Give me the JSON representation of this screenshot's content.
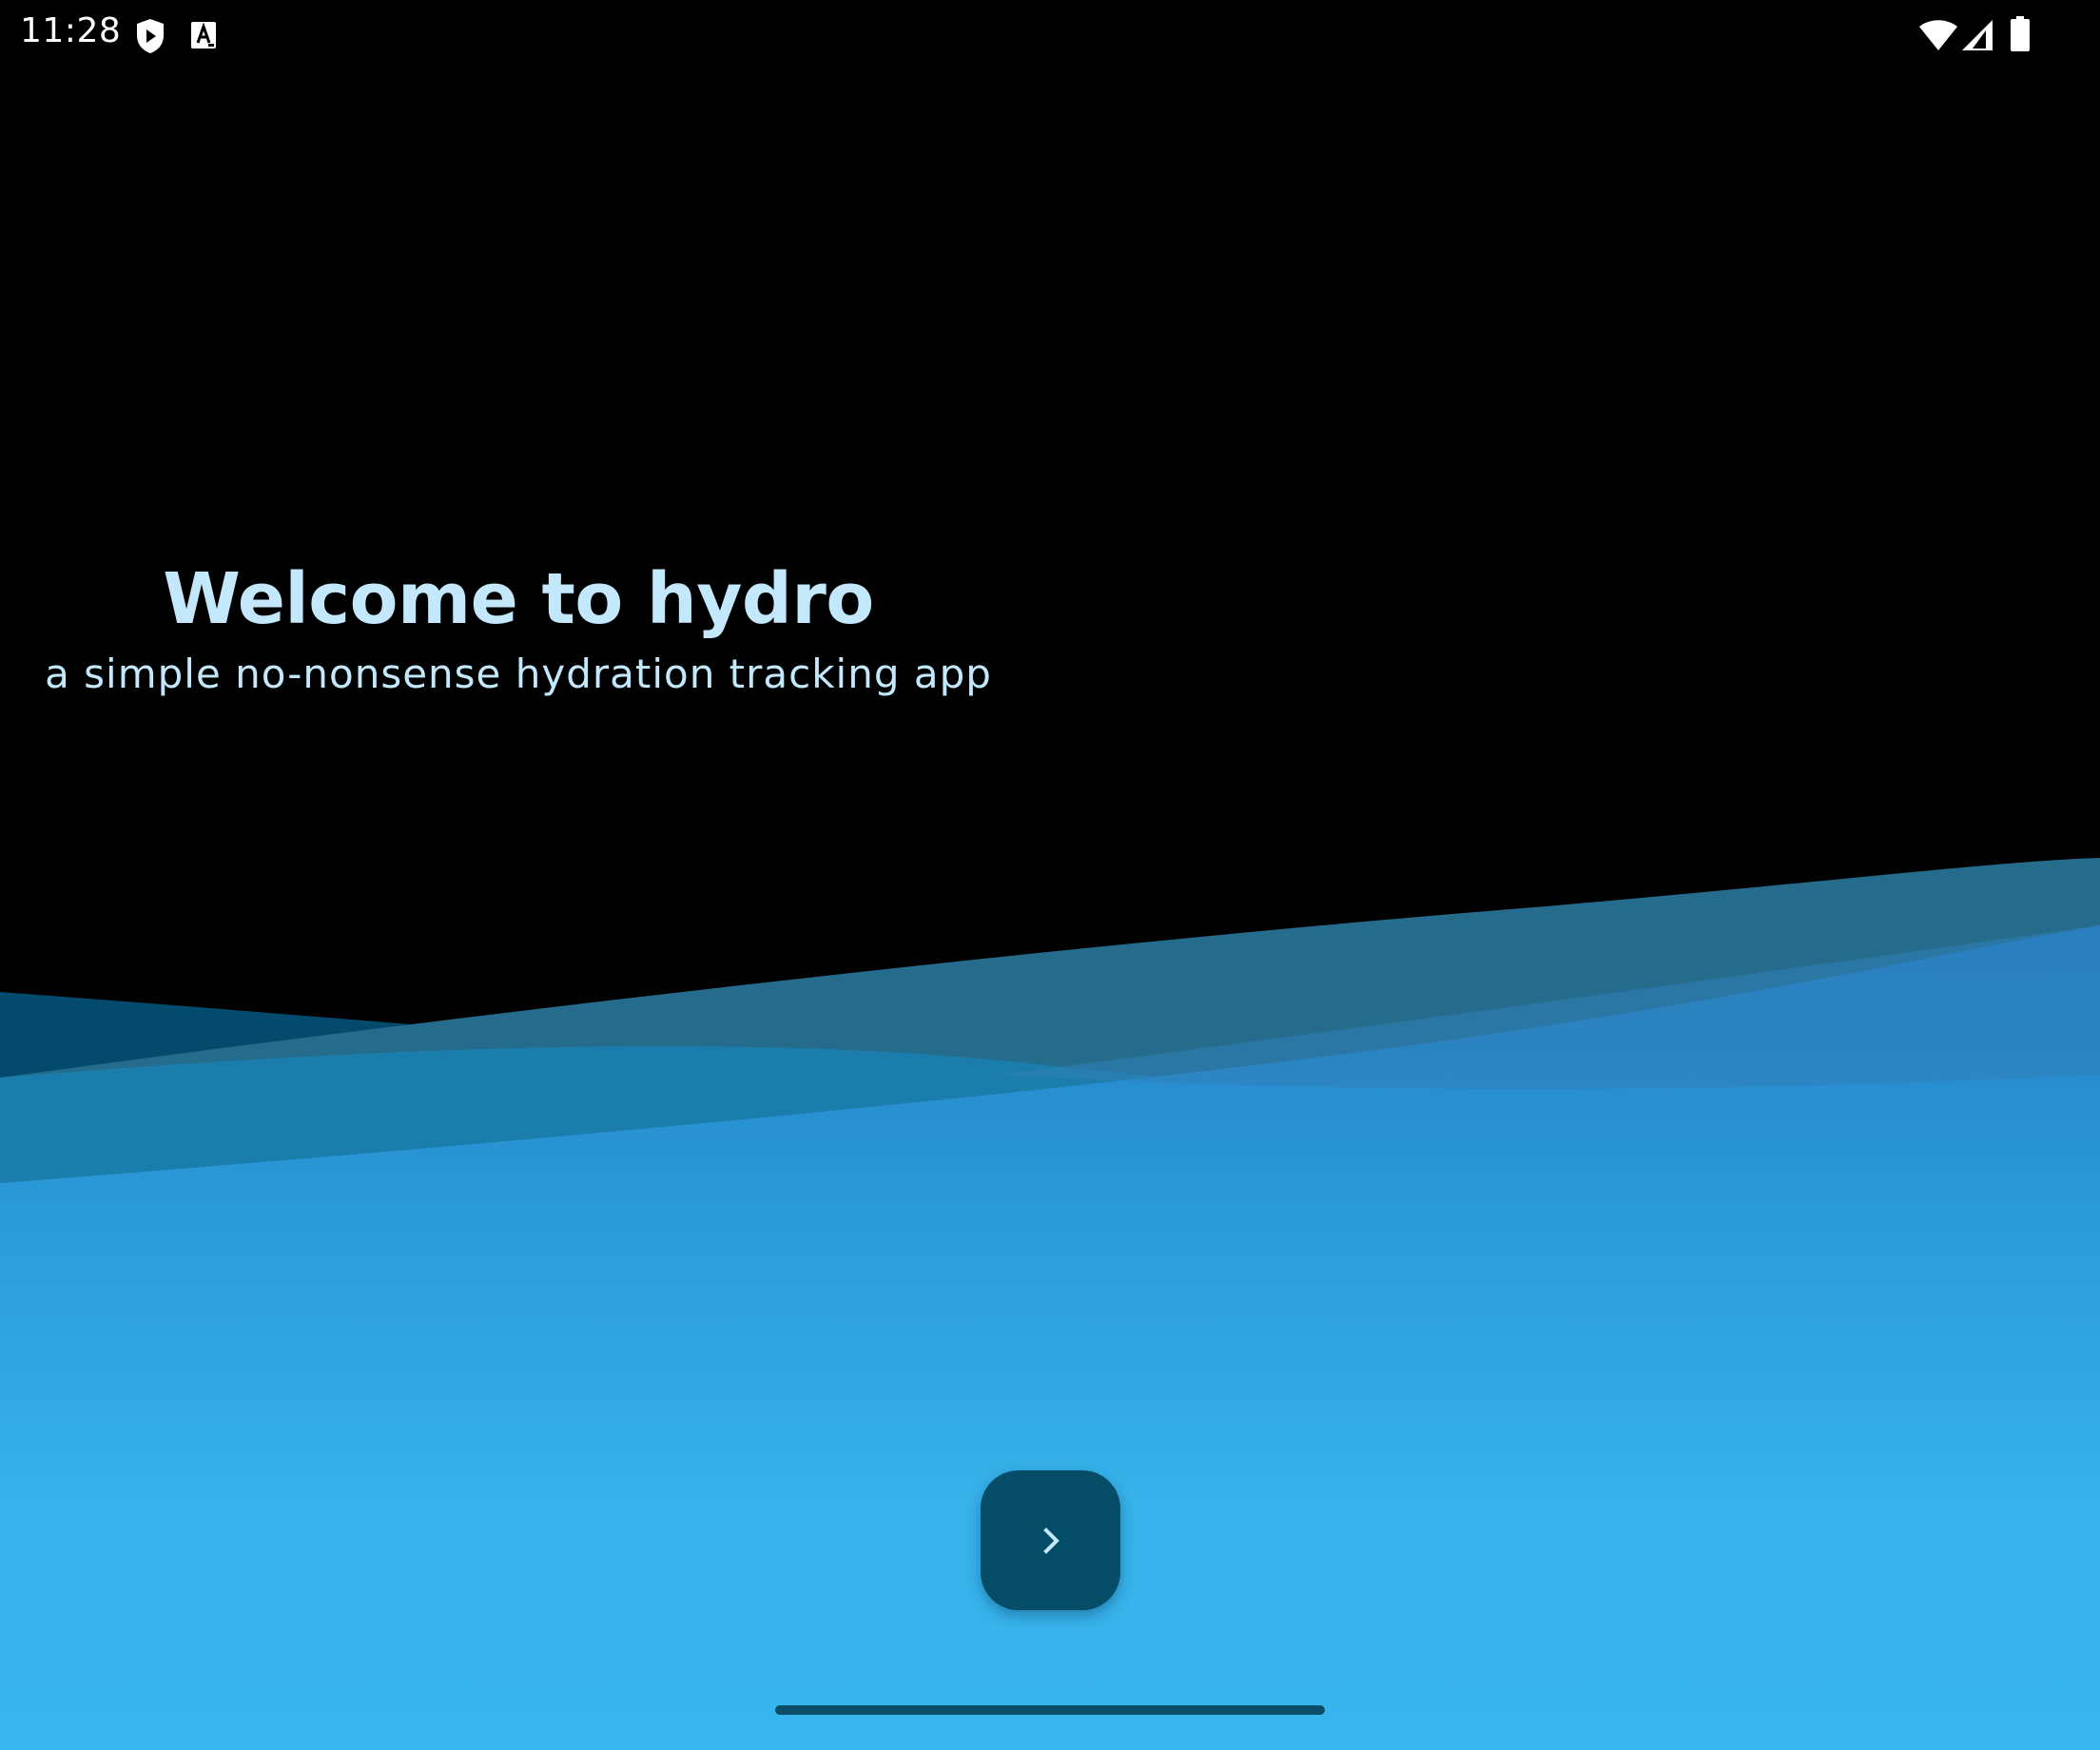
{
  "status_bar": {
    "time": "11:28",
    "icons": [
      "shield-play-icon",
      "font-a-icon",
      "wifi-icon",
      "signal-icon",
      "battery-icon"
    ]
  },
  "welcome": {
    "title": "Welcome to hydro",
    "subtitle": "a simple no-nonsense hydration tracking app"
  },
  "next_button": {
    "icon": "chevron-right-icon"
  },
  "colors": {
    "background": "#000000",
    "title_text": "#c4e8fb",
    "button": "#054d66",
    "water_light": "#38b4ee",
    "water_mid": "#2a93d3",
    "wave_dark": "#044a6c",
    "wave_teal": "#246b8c"
  }
}
